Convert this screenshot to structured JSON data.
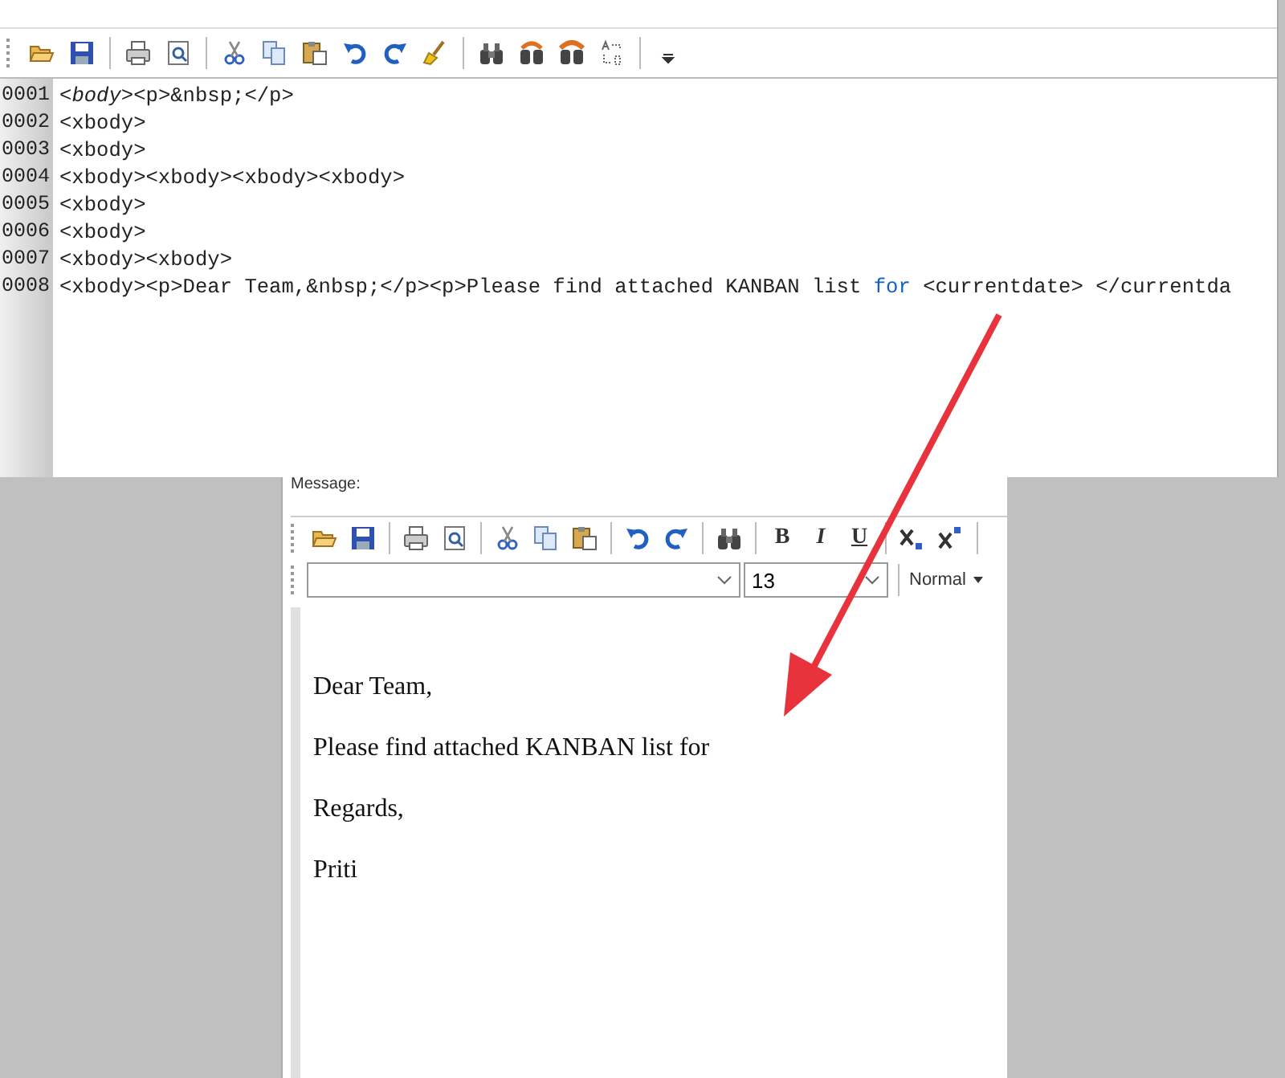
{
  "source_editor": {
    "lines": [
      {
        "number": "0001",
        "segments": [
          {
            "kind": "plain",
            "text": "<"
          },
          {
            "kind": "italic",
            "text": "body"
          },
          {
            "kind": "plain",
            "text": "><p>&nbsp;</p>"
          }
        ]
      },
      {
        "number": "0002",
        "segments": [
          {
            "kind": "plain",
            "text": "<xbody>"
          }
        ]
      },
      {
        "number": "0003",
        "segments": [
          {
            "kind": "plain",
            "text": "<xbody>"
          }
        ]
      },
      {
        "number": "0004",
        "segments": [
          {
            "kind": "plain",
            "text": "<xbody><xbody><xbody><xbody>"
          }
        ]
      },
      {
        "number": "0005",
        "segments": [
          {
            "kind": "plain",
            "text": "<xbody>"
          }
        ]
      },
      {
        "number": "0006",
        "segments": [
          {
            "kind": "plain",
            "text": "<xbody>"
          }
        ]
      },
      {
        "number": "0007",
        "segments": [
          {
            "kind": "plain",
            "text": "<xbody><xbody>"
          }
        ]
      },
      {
        "number": "0008",
        "segments": [
          {
            "kind": "plain",
            "text": "<xbody><p>Dear Team,&nbsp;</p><p>Please find attached KANBAN list "
          },
          {
            "kind": "keyword",
            "text": "for"
          },
          {
            "kind": "plain",
            "text": " <currentdate> </currentda"
          }
        ]
      }
    ]
  },
  "message_editor": {
    "label": "Message:",
    "format_buttons": [
      "B",
      "I",
      "U"
    ],
    "font_size": "13",
    "paragraph_style": "Normal",
    "paragraphs": [
      "Dear Team,",
      "Please find attached KANBAN list for",
      "Regards,",
      "Priti"
    ]
  }
}
